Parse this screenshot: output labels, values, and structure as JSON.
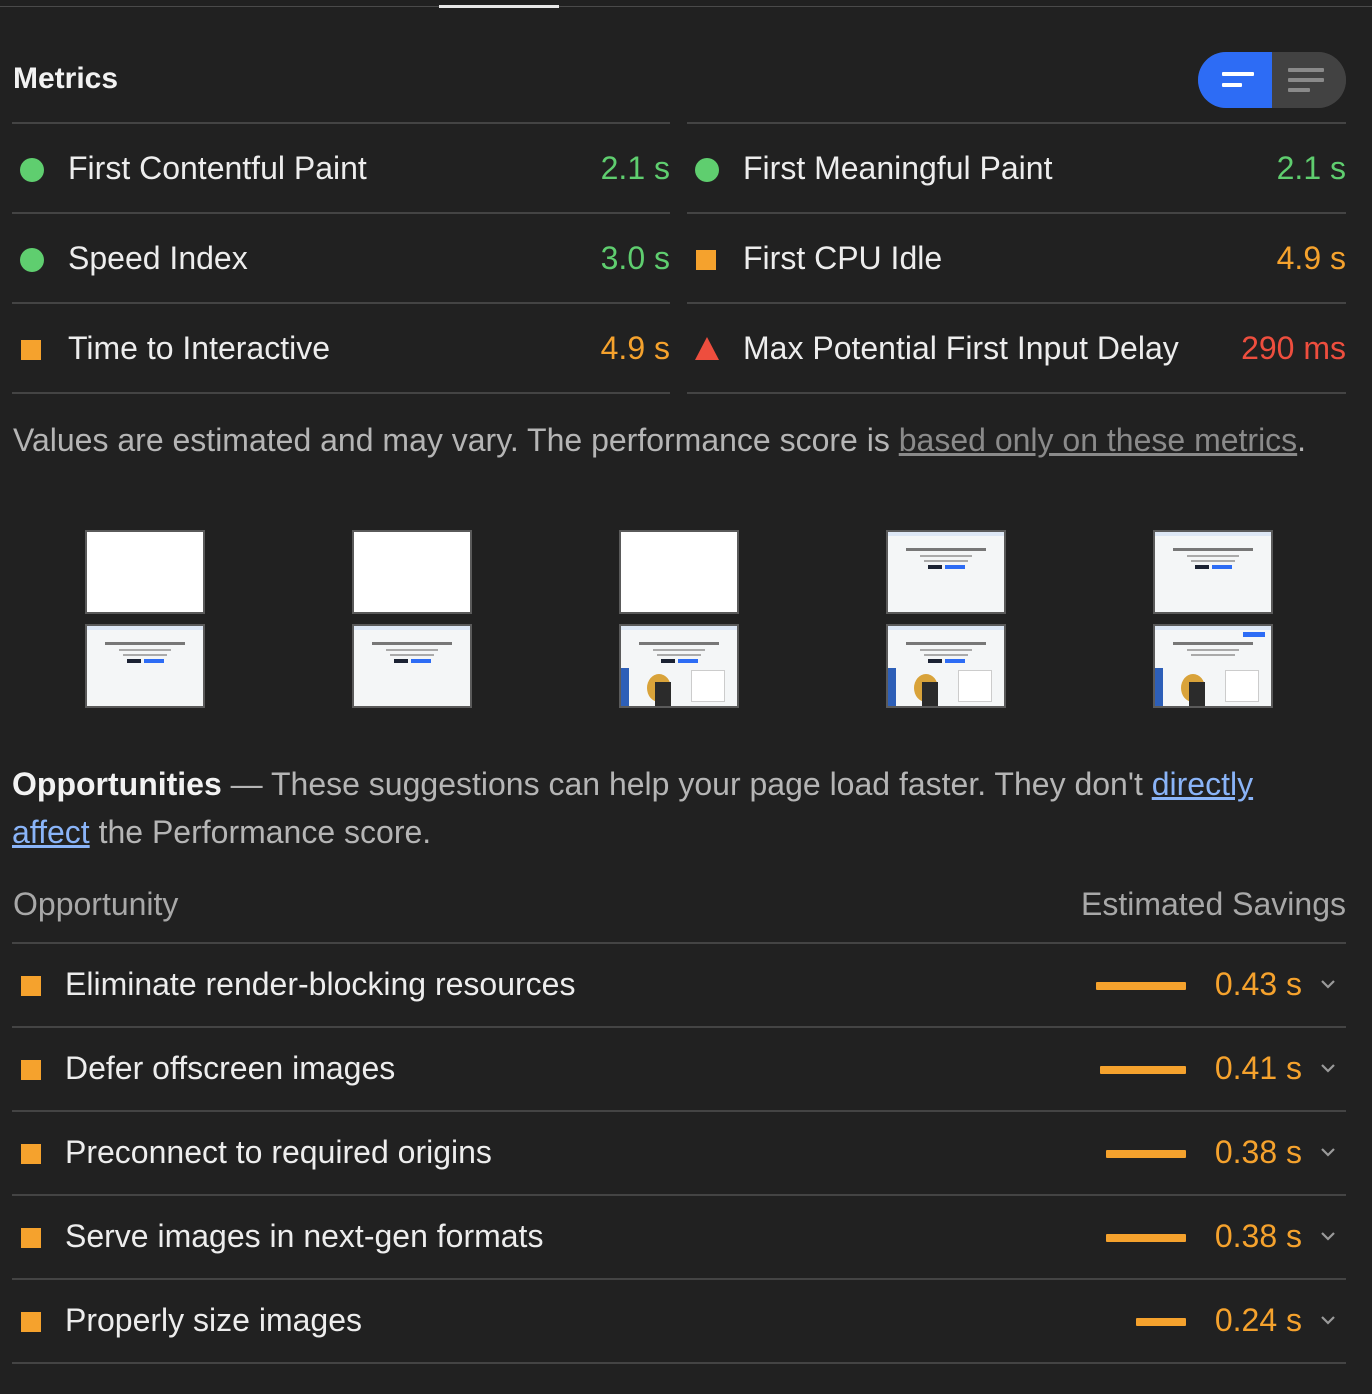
{
  "metrics": {
    "title": "Metrics",
    "items": [
      {
        "label": "First Contentful Paint",
        "value": "2.1 s",
        "status": "pass",
        "icon": "green-circle-icon"
      },
      {
        "label": "First Meaningful Paint",
        "value": "2.1 s",
        "status": "pass",
        "icon": "green-circle-icon"
      },
      {
        "label": "Speed Index",
        "value": "3.0 s",
        "status": "pass",
        "icon": "green-circle-icon"
      },
      {
        "label": "First CPU Idle",
        "value": "4.9 s",
        "status": "average",
        "icon": "orange-square-icon"
      },
      {
        "label": "Time to Interactive",
        "value": "4.9 s",
        "status": "average",
        "icon": "orange-square-icon"
      },
      {
        "label": "Max Potential First Input Delay",
        "value": "290 ms",
        "status": "fail",
        "icon": "red-triangle-icon"
      }
    ],
    "disclaimer_text": "Values are estimated and may vary. The performance score is ",
    "disclaimer_link": "based only on these metrics",
    "disclaimer_end": "."
  },
  "view_toggle": {
    "options": [
      "expanded-view-icon",
      "list-view-icon"
    ],
    "selected": "expanded-view-icon"
  },
  "opportunities": {
    "title": "Opportunities",
    "dash": " — ",
    "description": "These suggestions can help your page load faster. They don't ",
    "link": "directly affect",
    "description_end": " the Performance score.",
    "column_left": "Opportunity",
    "column_right": "Estimated Savings",
    "items": [
      {
        "label": "Eliminate render-blocking resources",
        "savings": "0.43 s",
        "savings_seconds": 0.43
      },
      {
        "label": "Defer offscreen images",
        "savings": "0.41 s",
        "savings_seconds": 0.41
      },
      {
        "label": "Preconnect to required origins",
        "savings": "0.38 s",
        "savings_seconds": 0.38
      },
      {
        "label": "Serve images in next-gen formats",
        "savings": "0.38 s",
        "savings_seconds": 0.38
      },
      {
        "label": "Properly size images",
        "savings": "0.24 s",
        "savings_seconds": 0.24
      }
    ]
  },
  "colors": {
    "pass": "#5fce6f",
    "average": "#f5a22d",
    "fail": "#ee4e3e",
    "accent": "#2d6cf5"
  }
}
